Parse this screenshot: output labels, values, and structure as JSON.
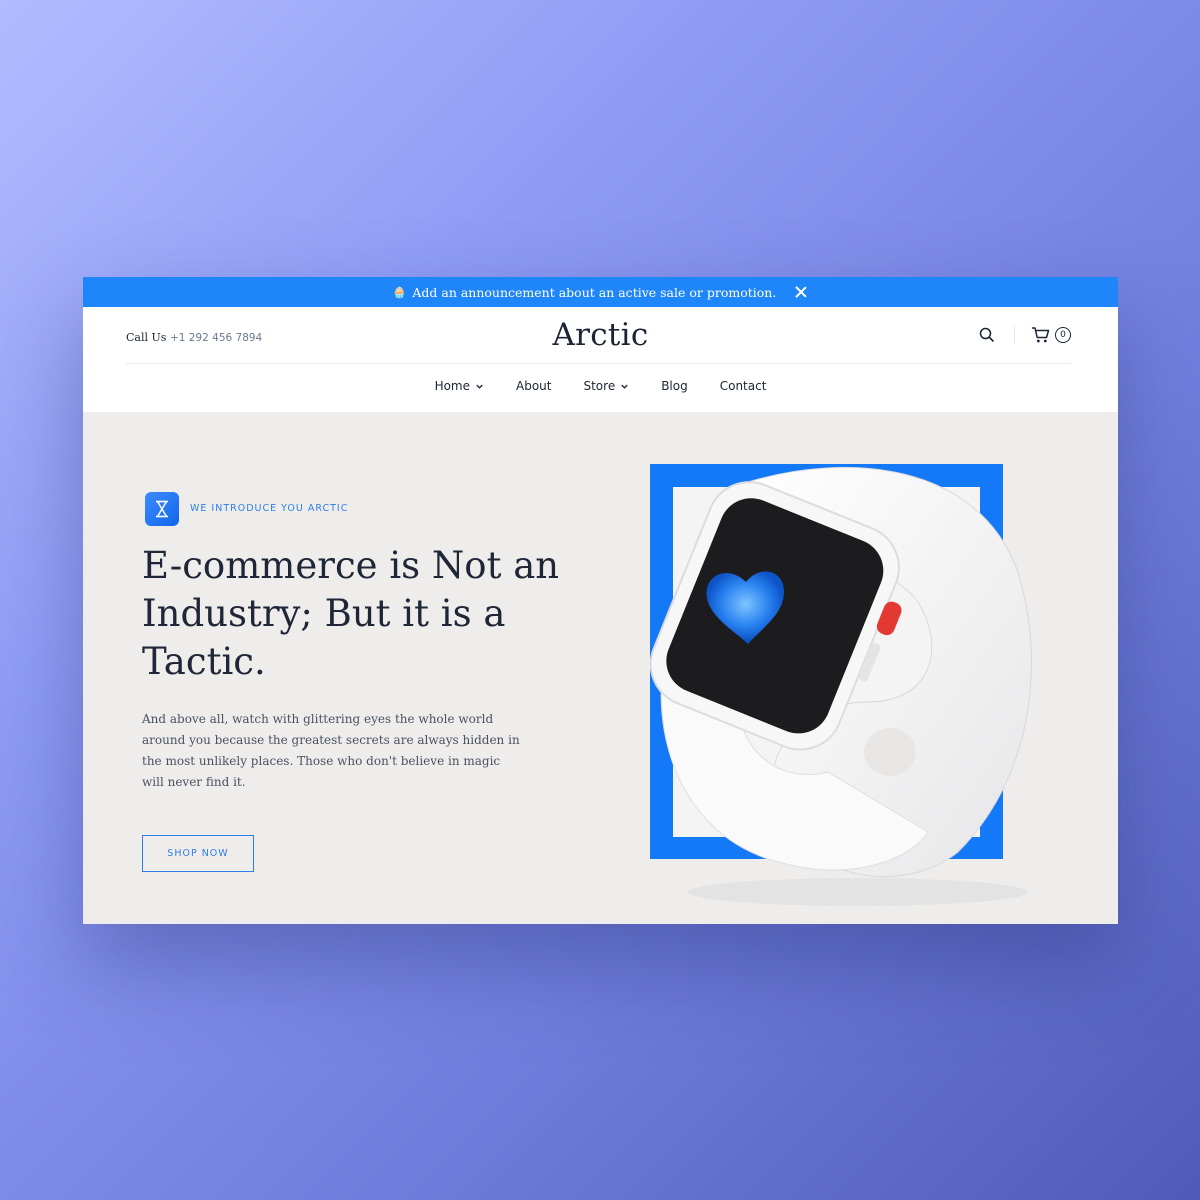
{
  "announcement": {
    "icon": "cupcake-icon",
    "text": "Add an announcement about an active sale or promotion."
  },
  "header": {
    "call_label": "Call Us",
    "phone": "+1 292 456 7894",
    "logo": "Arctic",
    "cart_count": "0"
  },
  "nav": {
    "items": [
      {
        "label": "Home",
        "dropdown": true
      },
      {
        "label": "About",
        "dropdown": false
      },
      {
        "label": "Store",
        "dropdown": true
      },
      {
        "label": "Blog",
        "dropdown": false
      },
      {
        "label": "Contact",
        "dropdown": false
      }
    ]
  },
  "hero": {
    "badge_icon": "hourglass-icon",
    "eyebrow": "WE INTRODUCE YOU ARCTIC",
    "headline": "E-commerce is Not an Industry; But it is a Tactic.",
    "paragraph": "And above all, watch with glittering eyes the whole world around you because the greatest secrets are always hidden in the most unlikely places. Those who don't believe in magic will never find it.",
    "button": "SHOP NOW"
  },
  "colors": {
    "accent": "#1e86f8",
    "text_dark": "#1c2434",
    "hero_bg": "#eeedec"
  }
}
